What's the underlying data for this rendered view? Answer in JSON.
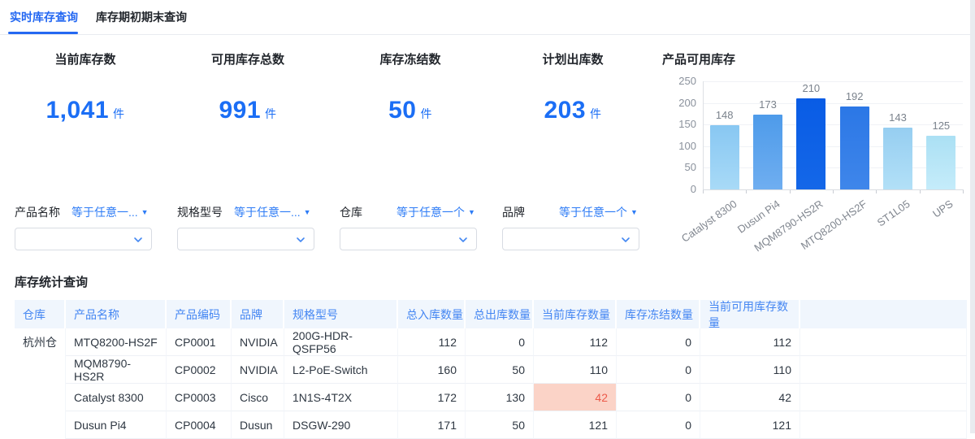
{
  "tabs": [
    {
      "label": "实时库存查询",
      "active": true
    },
    {
      "label": "库存期初期末查询",
      "active": false
    }
  ],
  "kpis": [
    {
      "label": "当前库存数",
      "value": "1,041",
      "unit": "件"
    },
    {
      "label": "可用库存总数",
      "value": "991",
      "unit": "件"
    },
    {
      "label": "库存冻结数",
      "value": "50",
      "unit": "件"
    },
    {
      "label": "计划出库数",
      "value": "203",
      "unit": "件"
    }
  ],
  "chart_data": {
    "type": "bar",
    "title": "产品可用库存",
    "categories": [
      "Catalyst 8300",
      "Dusun Pi4",
      "MQM8790-HS2R",
      "MTQ8200-HS2F",
      "ST1L05",
      "UPS"
    ],
    "values": [
      148,
      173,
      210,
      192,
      143,
      125
    ],
    "xlabel": "",
    "ylabel": "",
    "ylim": [
      0,
      250
    ],
    "ytick_step": 50,
    "grid": true,
    "legend": false,
    "bar_colors": [
      [
        "#88C7F2",
        "#A8DAF7"
      ],
      [
        "#4E9BEA",
        "#6FAEF0"
      ],
      [
        "#095CE5",
        "#1467E8"
      ],
      [
        "#2B77E6",
        "#3F86EA"
      ],
      [
        "#96CEF1",
        "#B2E0F7"
      ],
      [
        "#ABE0F4",
        "#C5ECFA"
      ]
    ]
  },
  "filters": [
    {
      "label": "产品名称",
      "operator": "等于任意一...",
      "value": ""
    },
    {
      "label": "规格型号",
      "operator": "等于任意一...",
      "value": ""
    },
    {
      "label": "仓库",
      "operator": "等于任意一个",
      "value": ""
    },
    {
      "label": "品牌",
      "operator": "等于任意一个",
      "value": ""
    }
  ],
  "table": {
    "title": "库存统计查询",
    "columns": [
      "仓库",
      "产品名称",
      "产品编码",
      "品牌",
      "规格型号",
      "总入库数量",
      "总出库数量",
      "当前库存数量",
      "库存冻结数量",
      "当前可用库存数量"
    ],
    "rows": [
      {
        "cells": [
          "杭州仓",
          "MTQ8200-HS2F",
          "CP0001",
          "NVIDIA",
          "200G-HDR-QSFP56",
          "112",
          "0",
          "112",
          "0",
          "112"
        ],
        "highlight_cols": []
      },
      {
        "cells": [
          "",
          "MQM8790-HS2R",
          "CP0002",
          "NVIDIA",
          "L2-PoE-Switch",
          "160",
          "50",
          "110",
          "0",
          "110"
        ],
        "highlight_cols": []
      },
      {
        "cells": [
          "",
          "Catalyst 8300",
          "CP0003",
          "Cisco",
          "1N1S-4T2X",
          "172",
          "130",
          "42",
          "0",
          "42"
        ],
        "highlight_cols": [
          7
        ]
      },
      {
        "cells": [
          "",
          "Dusun Pi4",
          "CP0004",
          "Dusun",
          "DSGW-290",
          "171",
          "50",
          "121",
          "0",
          "121"
        ],
        "highlight_cols": []
      }
    ]
  },
  "colors": {
    "accent": "#2468F2",
    "kpi_value": "#1B6EF5",
    "operator_link": "#2E7CF6",
    "table_header_text": "#4486F2",
    "table_header_bg": "#F0F6FD",
    "highlight_bg": "#FBD3C7",
    "highlight_text": "#EC5A4A"
  }
}
